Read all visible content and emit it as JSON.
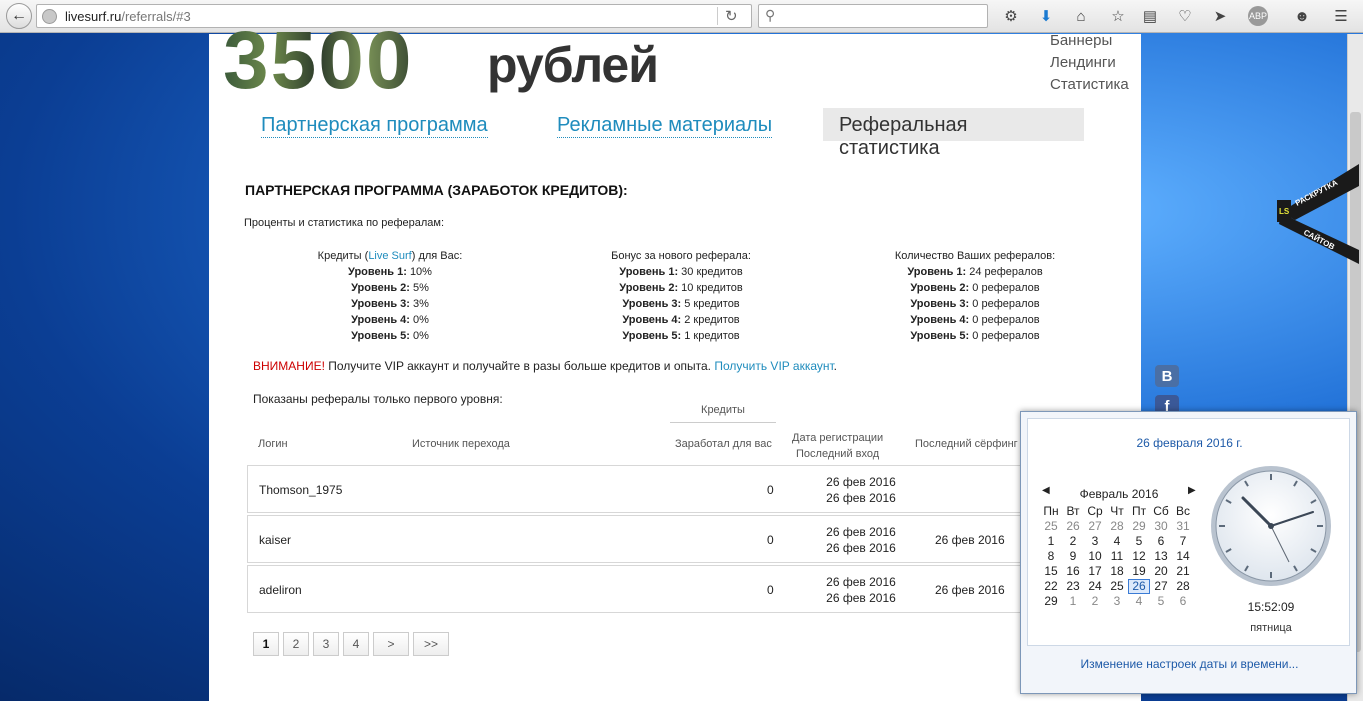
{
  "browser": {
    "url_host": "livesurf.ru",
    "url_path": "/referrals/#3",
    "search_placeholder": ""
  },
  "header": {
    "amount": "3500",
    "currency": "рублей",
    "side_links": [
      "Баннеры",
      "Лендинги",
      "Статистика"
    ]
  },
  "tabs": [
    "Партнерская программа",
    "Рекламные материалы",
    "Реферальная статистика"
  ],
  "section": {
    "title": "ПАРТНЕРСКАЯ ПРОГРАММА (ЗАРАБОТОК КРЕДИТОВ):",
    "subtitle": "Проценты и статистика по рефералам:"
  },
  "stats": {
    "credits": {
      "head_pre": "Кредиты (",
      "head_link": "Live Surf",
      "head_post": ") для Вас:",
      "levels": [
        {
          "label": "Уровень 1:",
          "value": "10%"
        },
        {
          "label": "Уровень 2:",
          "value": "5%"
        },
        {
          "label": "Уровень 3:",
          "value": "3%"
        },
        {
          "label": "Уровень 4:",
          "value": "0%"
        },
        {
          "label": "Уровень 5:",
          "value": "0%"
        }
      ]
    },
    "bonus": {
      "head": "Бонус за нового реферала:",
      "levels": [
        {
          "label": "Уровень 1:",
          "value": "30 кредитов"
        },
        {
          "label": "Уровень 2:",
          "value": "10 кредитов"
        },
        {
          "label": "Уровень 3:",
          "value": "5 кредитов"
        },
        {
          "label": "Уровень 4:",
          "value": "2 кредитов"
        },
        {
          "label": "Уровень 5:",
          "value": "1 кредитов"
        }
      ]
    },
    "count": {
      "head": "Количество Ваших рефералов:",
      "levels": [
        {
          "label": "Уровень 1:",
          "value": "24 рефералов"
        },
        {
          "label": "Уровень 2:",
          "value": "0 рефералов"
        },
        {
          "label": "Уровень 3:",
          "value": "0 рефералов"
        },
        {
          "label": "Уровень 4:",
          "value": "0 рефералов"
        },
        {
          "label": "Уровень 5:",
          "value": "0 рефералов"
        }
      ]
    }
  },
  "warning": {
    "label": "ВНИМАНИЕ!",
    "text": " Получите VIP аккаунт и получайте в разы больше кредитов и опыта. ",
    "link": "Получить VIP аккаунт",
    "end": "."
  },
  "shown_note": "Показаны рефералы только первого уровня:",
  "table": {
    "credits_group": "Кредиты",
    "col_login": "Логин",
    "col_source": "Источник перехода",
    "col_earned": "Заработал для вас",
    "col_reg": "Дата регистрации",
    "col_lastlogin": "Последний вход",
    "col_lastsurf": "Последний сёрфинг",
    "rows": [
      {
        "login": "Thomson_1975",
        "earned": "0",
        "reg": "26 фев 2016",
        "lastlogin": "26 фев 2016",
        "lastsurf": ""
      },
      {
        "login": "kaiser",
        "earned": "0",
        "reg": "26 фев 2016",
        "lastlogin": "26 фев 2016",
        "lastsurf": "26 фев 2016"
      },
      {
        "login": "adeliron",
        "earned": "0",
        "reg": "26 фев 2016",
        "lastlogin": "26 фев 2016",
        "lastsurf": "26 фев 2016"
      }
    ]
  },
  "pager": [
    "1",
    "2",
    "3",
    "4",
    ">",
    ">>"
  ],
  "ribbon": {
    "badge": "LS",
    "line1": "РАСКРУТКА",
    "line2": "САЙТОВ"
  },
  "social": {
    "vk": "В",
    "fb": "f"
  },
  "calendar": {
    "full_date": "26 февраля 2016 г.",
    "month": "Февраль 2016",
    "weekdays": [
      "Пн",
      "Вт",
      "Ср",
      "Чт",
      "Пт",
      "Сб",
      "Вс"
    ],
    "days": [
      {
        "d": "25",
        "o": true
      },
      {
        "d": "26",
        "o": true
      },
      {
        "d": "27",
        "o": true
      },
      {
        "d": "28",
        "o": true
      },
      {
        "d": "29",
        "o": true
      },
      {
        "d": "30",
        "o": true
      },
      {
        "d": "31",
        "o": true
      },
      {
        "d": "1"
      },
      {
        "d": "2"
      },
      {
        "d": "3"
      },
      {
        "d": "4"
      },
      {
        "d": "5"
      },
      {
        "d": "6"
      },
      {
        "d": "7"
      },
      {
        "d": "8"
      },
      {
        "d": "9"
      },
      {
        "d": "10"
      },
      {
        "d": "11"
      },
      {
        "d": "12"
      },
      {
        "d": "13"
      },
      {
        "d": "14"
      },
      {
        "d": "15"
      },
      {
        "d": "16"
      },
      {
        "d": "17"
      },
      {
        "d": "18"
      },
      {
        "d": "19"
      },
      {
        "d": "20"
      },
      {
        "d": "21"
      },
      {
        "d": "22"
      },
      {
        "d": "23"
      },
      {
        "d": "24"
      },
      {
        "d": "25"
      },
      {
        "d": "26",
        "today": true
      },
      {
        "d": "27"
      },
      {
        "d": "28"
      },
      {
        "d": "29"
      },
      {
        "d": "1",
        "o": true
      },
      {
        "d": "2",
        "o": true
      },
      {
        "d": "3",
        "o": true
      },
      {
        "d": "4",
        "o": true
      },
      {
        "d": "5",
        "o": true
      },
      {
        "d": "6",
        "o": true
      }
    ],
    "time": "15:52:09",
    "weekday_name": "пятница",
    "settings_link": "Изменение настроек даты и времени..."
  }
}
